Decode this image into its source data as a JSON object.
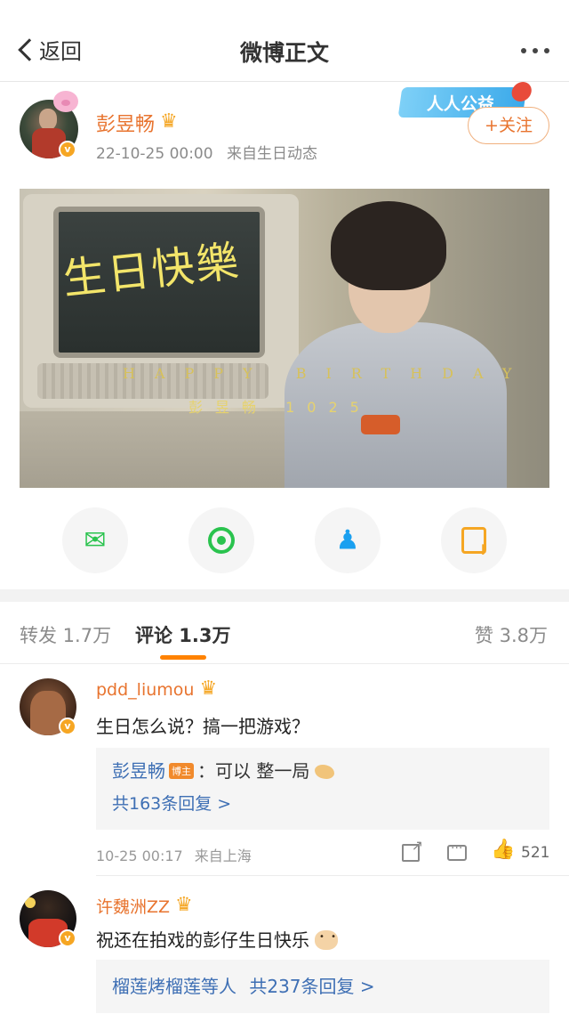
{
  "nav": {
    "back_label": "返回",
    "title": "微博正文"
  },
  "post": {
    "author": "彭昱畅",
    "time": "22-10-25 00:00",
    "source": "来自生日动态",
    "follow_label": "+关注",
    "banner_text": "人人公益",
    "image": {
      "title_text": "生日快樂",
      "subtitle_text": "HAPPY BIRTHDAY",
      "signature_text": "彭昱畅 1025"
    }
  },
  "share": {
    "items": [
      "wechat-icon",
      "moments-icon",
      "qq-icon",
      "save-image-icon"
    ]
  },
  "tabs": {
    "forward": "转发 1.7万",
    "comment": "评论 1.3万",
    "like": "赞 3.8万"
  },
  "comments": [
    {
      "name": "pdd_liumou",
      "text": "生日怎么说？搞一把游戏？",
      "reply_author": "彭昱畅",
      "reply_tag": "博主",
      "reply_text": "：可以 整一局",
      "reply_count": "共163条回复 >",
      "time": "10-25 00:17",
      "source": "来自上海",
      "likes": "521"
    },
    {
      "name": "许魏洲ZZ",
      "text": "祝还在拍戏的彭仔生日快乐",
      "reply_prefix": "榴莲烤榴莲等人",
      "reply_count": "共237条回复 >"
    }
  ],
  "colors": {
    "brand_orange": "#ff8200",
    "name_orange": "#e8742f",
    "link_blue": "#3e6fb4"
  }
}
